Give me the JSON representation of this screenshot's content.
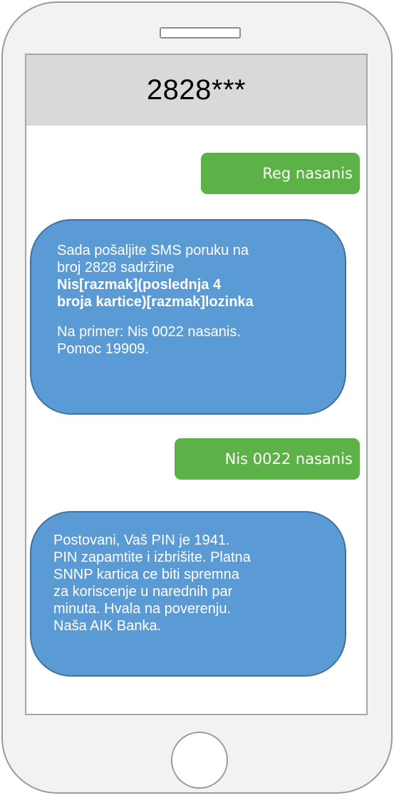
{
  "conversation": {
    "title": "2828***"
  },
  "messages": {
    "sent_1": "Reg nasanis",
    "received_1": {
      "line_1": "Sada pošaljite SMS poruku na",
      "line_2": "broj 2828 sadržine",
      "bold_1": "Nis[razmak](poslednja 4",
      "bold_2": "broja kartice)[razmak]lozinka",
      "line_3": "Na primer: Nis 0022 nasanis.",
      "line_4": "Pomoc 19909."
    },
    "sent_2": "Nis 0022 nasanis",
    "received_2": {
      "line_1": "Postovani, Vaš PIN je 1941.",
      "line_2": "PIN zapamtite i izbrišite. Platna",
      "line_3": "SNNP kartica ce biti spremna",
      "line_4": "za koriscenje u narednih par",
      "line_5": "minuta. Hvala na poverenju.",
      "line_6": "Naša AIK Banka."
    }
  },
  "colors": {
    "sent_bubble": "#5cb246",
    "received_bubble": "#5b9bd5",
    "received_border": "#41719c",
    "header_bg": "#d9d9d9",
    "phone_body": "#f2f2f2"
  }
}
